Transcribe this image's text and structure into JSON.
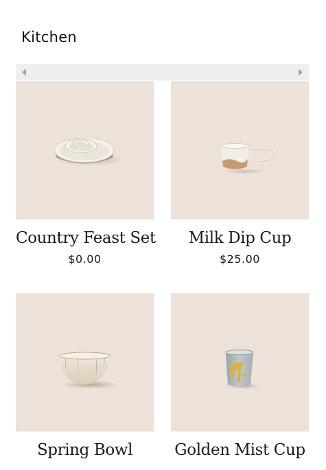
{
  "page": {
    "title": "Kitchen"
  },
  "colors": {
    "product_background": "#ede2da",
    "scrollbar_track": "#efefef",
    "scrollbar_arrow": "#a3a3a3"
  },
  "products": [
    {
      "name": "Country Feast Set",
      "price": "$0.00",
      "image_icon": "nested-bowls-icon"
    },
    {
      "name": "Milk Dip Cup",
      "price": "$25.00",
      "image_icon": "mug-icon"
    },
    {
      "name": "Spring Bowl",
      "price": "",
      "image_icon": "bowl-icon"
    },
    {
      "name": "Golden Mist Cup",
      "price": "",
      "image_icon": "tumbler-icon"
    }
  ]
}
